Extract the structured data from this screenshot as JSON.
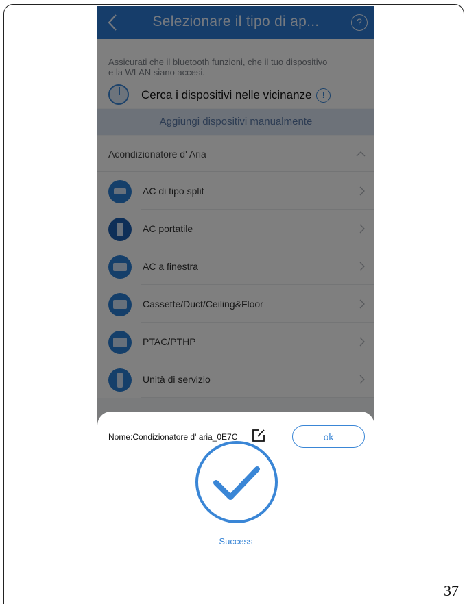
{
  "header": {
    "title": "Selezionare il tipo di ap...",
    "back_icon": "chevron-left-icon",
    "help_symbol": "?"
  },
  "info": {
    "note": "Assicurati che il bluetooth funzioni, che il tuo dispositivo e la WLAN siano accesi.",
    "scan_label": "Cerca i dispositivi nelle vicinanze",
    "scan_info_symbol": "!"
  },
  "manual_button": "Aggiungi dispositivi manualmente",
  "section": {
    "label": "Acondizionatore d' Aria",
    "expanded": true
  },
  "items": [
    {
      "label": "AC di tipo split",
      "icon": "split-ac-icon"
    },
    {
      "label": "AC portatile",
      "icon": "portable-ac-icon"
    },
    {
      "label": "AC a finestra",
      "icon": "window-ac-icon"
    },
    {
      "label": "Cassette/Duct/Ceiling&Floor",
      "icon": "cassette-ac-icon"
    },
    {
      "label": "PTAC/PTHP",
      "icon": "ptac-icon"
    },
    {
      "label": "Unità di servizio",
      "icon": "service-unit-icon"
    }
  ],
  "sheet": {
    "device_name": "Nome:Condizionatore d' aria_0E7C",
    "ok_label": "ok",
    "success_label": "Success"
  },
  "page_number": "37",
  "colors": {
    "accent": "#3a86d6",
    "header": "#2d7bd4",
    "icon_bg": "#2a7fd4",
    "overlay": "rgba(0,0,0,0.5)"
  }
}
